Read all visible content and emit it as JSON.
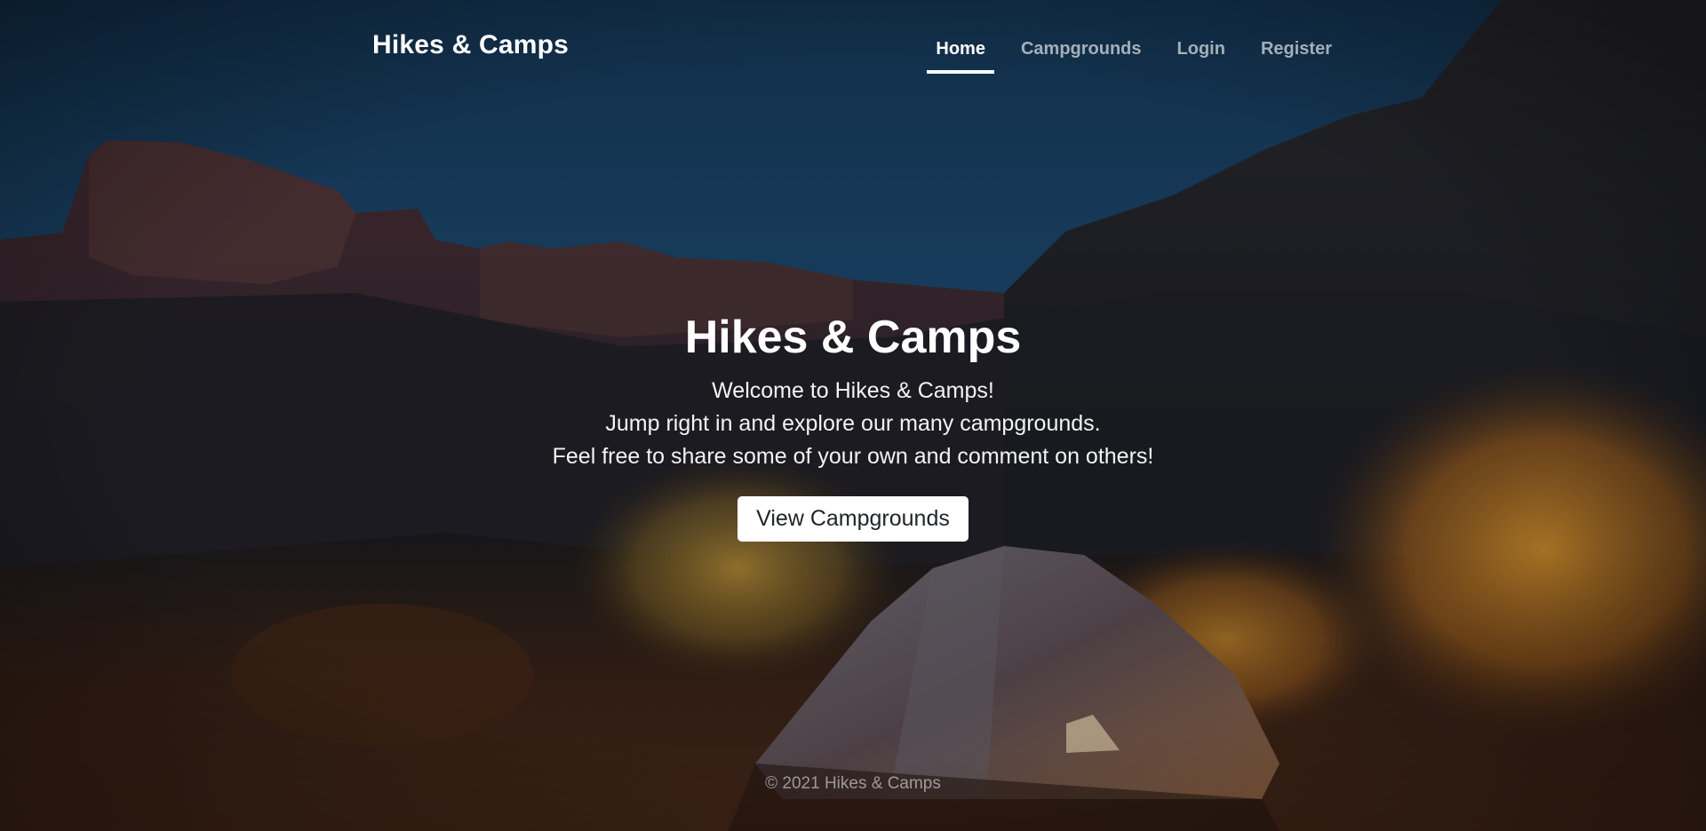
{
  "header": {
    "brand": "Hikes & Camps",
    "nav": [
      {
        "label": "Home",
        "active": true
      },
      {
        "label": "Campgrounds",
        "active": false
      },
      {
        "label": "Login",
        "active": false
      },
      {
        "label": "Register",
        "active": false
      }
    ]
  },
  "hero": {
    "title": "Hikes & Camps",
    "lines": [
      "Welcome to Hikes & Camps!",
      "Jump right in and explore our many campgrounds.",
      "Feel free to share some of your own and comment on others!"
    ],
    "button_label": "View Campgrounds"
  },
  "footer": {
    "text": "© 2021 Hikes & Camps"
  },
  "colors": {
    "sky": "#1b4263",
    "text": "#ffffff",
    "button_bg": "#ffffff",
    "button_text": "#212529"
  }
}
